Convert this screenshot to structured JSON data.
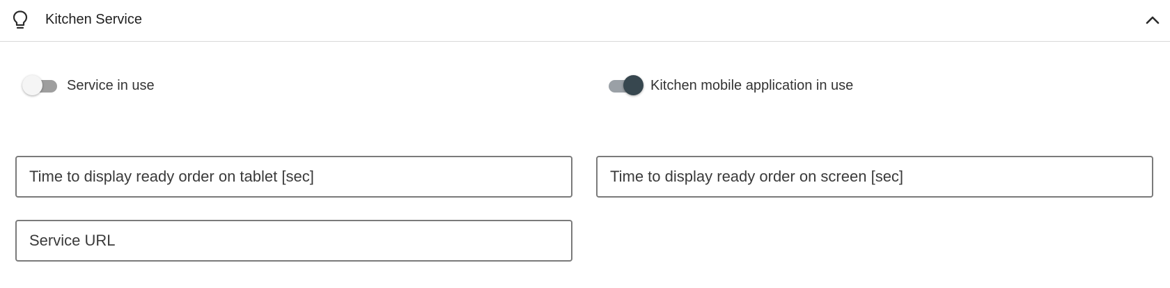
{
  "section": {
    "title": "Kitchen Service",
    "icon": "lightbulb-icon",
    "collapse_icon": "chevron-up-icon",
    "expanded": true
  },
  "toggles": [
    {
      "label": "Service in use",
      "on": false
    },
    {
      "label": "Kitchen mobile application in use",
      "on": true
    }
  ],
  "fields": {
    "tablet_time": {
      "value": "",
      "placeholder": "Time to display ready order on tablet [sec]"
    },
    "screen_time": {
      "value": "",
      "placeholder": "Time to display ready order on screen [sec]"
    },
    "service_url": {
      "value": "",
      "placeholder": "Service URL"
    }
  },
  "colors": {
    "toggle_on_knob": "#37474f",
    "toggle_track": "#9e9e9e",
    "field_border": "#7a7a7a",
    "divider": "#d9d9d9"
  }
}
